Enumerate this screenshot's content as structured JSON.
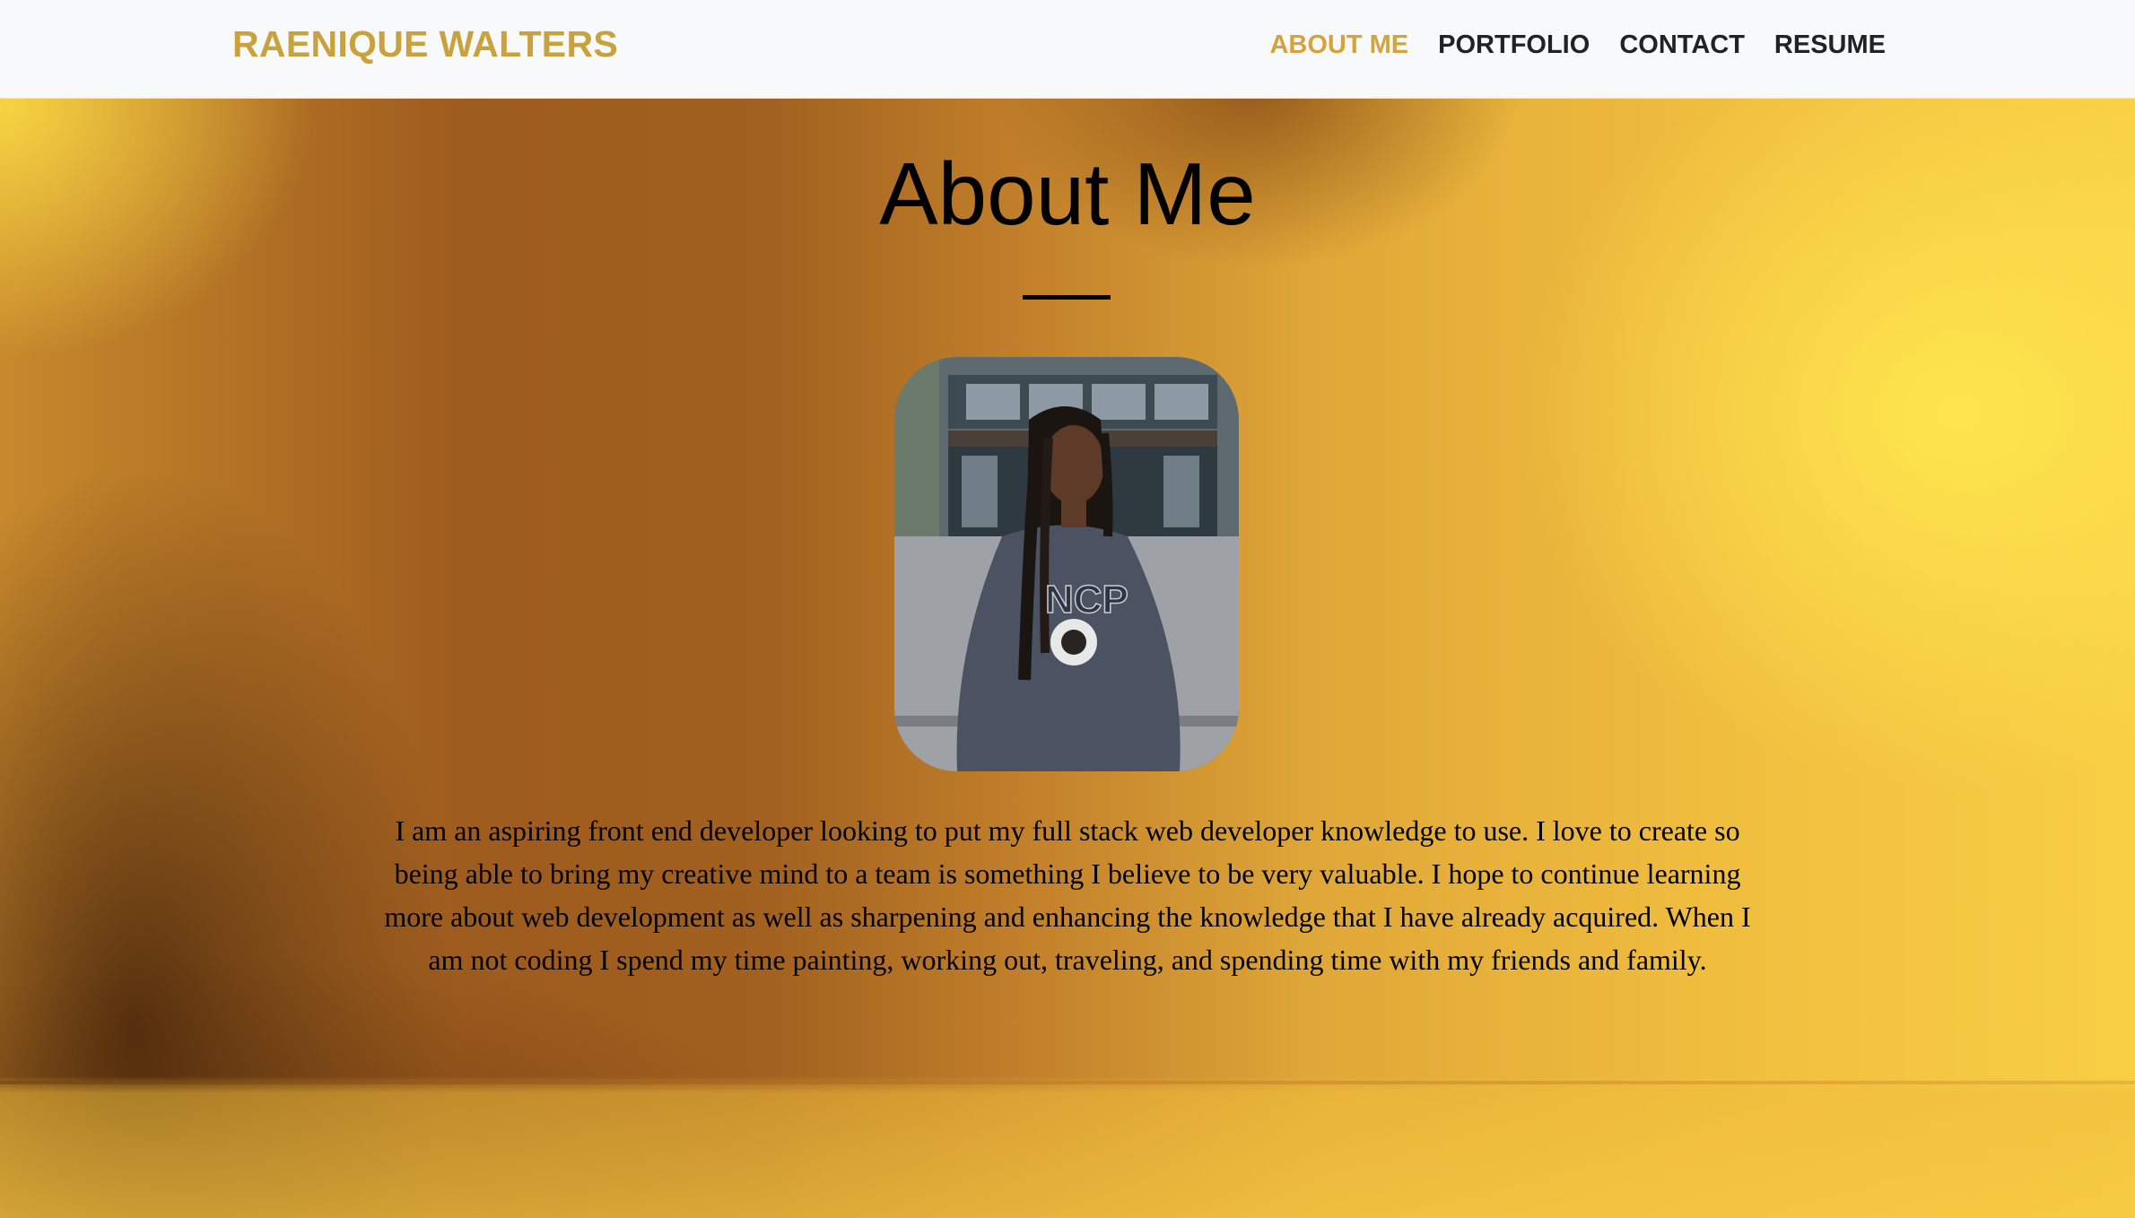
{
  "header": {
    "brand": "RAENIQUE WALTERS",
    "nav": [
      {
        "label": "ABOUT ME",
        "active": true
      },
      {
        "label": "PORTFOLIO",
        "active": false
      },
      {
        "label": "CONTACT",
        "active": false
      },
      {
        "label": "RESUME",
        "active": false
      }
    ]
  },
  "main": {
    "title": "About Me",
    "bio": "I am an aspiring front end developer looking to put my full stack web developer knowledge to use. I love to create so being able to bring my creative mind to a team is something I believe to be very valuable. I hope to continue learning more about web development as well as sharpening and enhancing the knowledge that I have already acquired. When I am not coding I spend my time painting, working out, traveling, and spending time with my friends and family."
  },
  "colors": {
    "accent": "#c9a23e",
    "nav_text": "#222222",
    "header_bg": "#f8f9fa"
  }
}
